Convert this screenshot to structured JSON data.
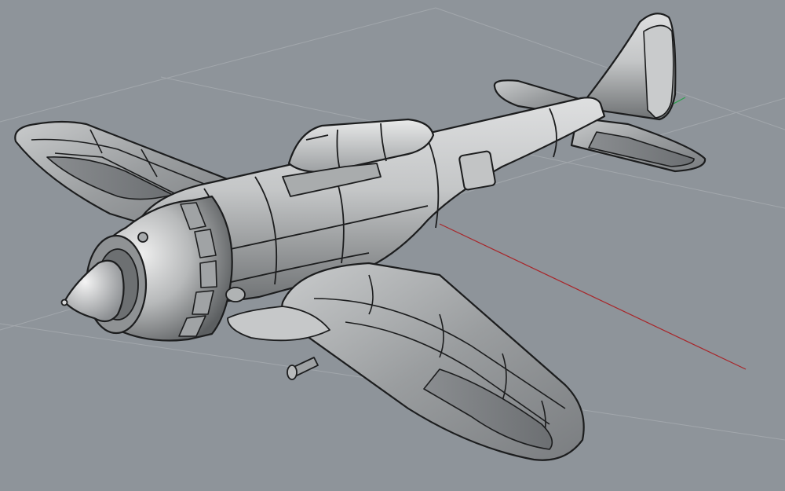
{
  "viewport": {
    "background": "#8e949a",
    "grid_color": "#a2a7ac",
    "x_axis_color": "#a8262a",
    "y_axis_color": "#2aa24a",
    "model": "airplane-model"
  },
  "model": {
    "base_color": "#b9bbbc",
    "light_color": "#e6e7e7",
    "shadow_color": "#5f6264",
    "outline_color": "#1c1d1e"
  }
}
